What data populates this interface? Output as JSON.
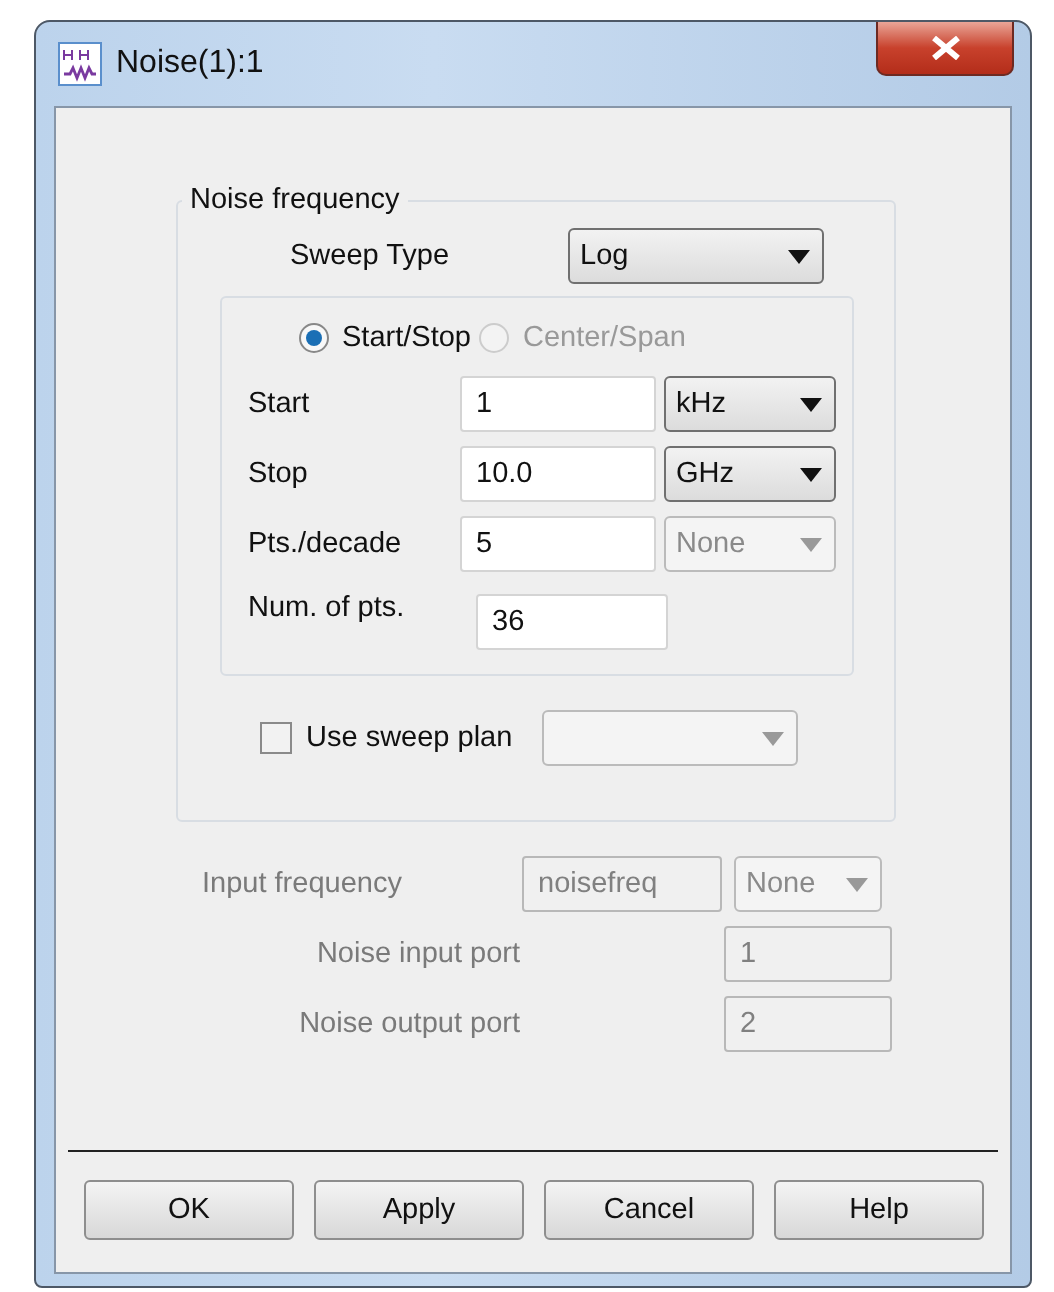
{
  "window": {
    "title": "Noise(1):1"
  },
  "noise_frequency": {
    "title": "Noise frequency",
    "sweep_type": {
      "label": "Sweep Type",
      "value": "Log"
    },
    "modes": [
      {
        "label": "Start/Stop",
        "selected": true,
        "disabled": false
      },
      {
        "label": "Center/Span",
        "selected": false,
        "disabled": true
      }
    ],
    "rows": [
      {
        "label": "Start",
        "value": "1",
        "unit": "kHz",
        "unit_disabled": false
      },
      {
        "label": "Stop",
        "value": "10.0",
        "unit": "GHz",
        "unit_disabled": false
      },
      {
        "label": "Pts./decade",
        "value": "5",
        "unit": "None",
        "unit_disabled": true
      }
    ],
    "num_points": {
      "label": "Num. of pts.",
      "value": "36"
    },
    "sweep_plan": {
      "label": "Use sweep plan",
      "checked": false,
      "combo_disabled": true
    }
  },
  "input_frequency": {
    "label": "Input frequency",
    "value": "noisefreq",
    "unit": "None",
    "disabled": true
  },
  "ports": [
    {
      "label": "Noise input port",
      "value": "1",
      "disabled": true
    },
    {
      "label": "Noise output port",
      "value": "2",
      "disabled": true
    }
  ],
  "buttons": [
    "OK",
    "Apply",
    "Cancel",
    "Help"
  ]
}
